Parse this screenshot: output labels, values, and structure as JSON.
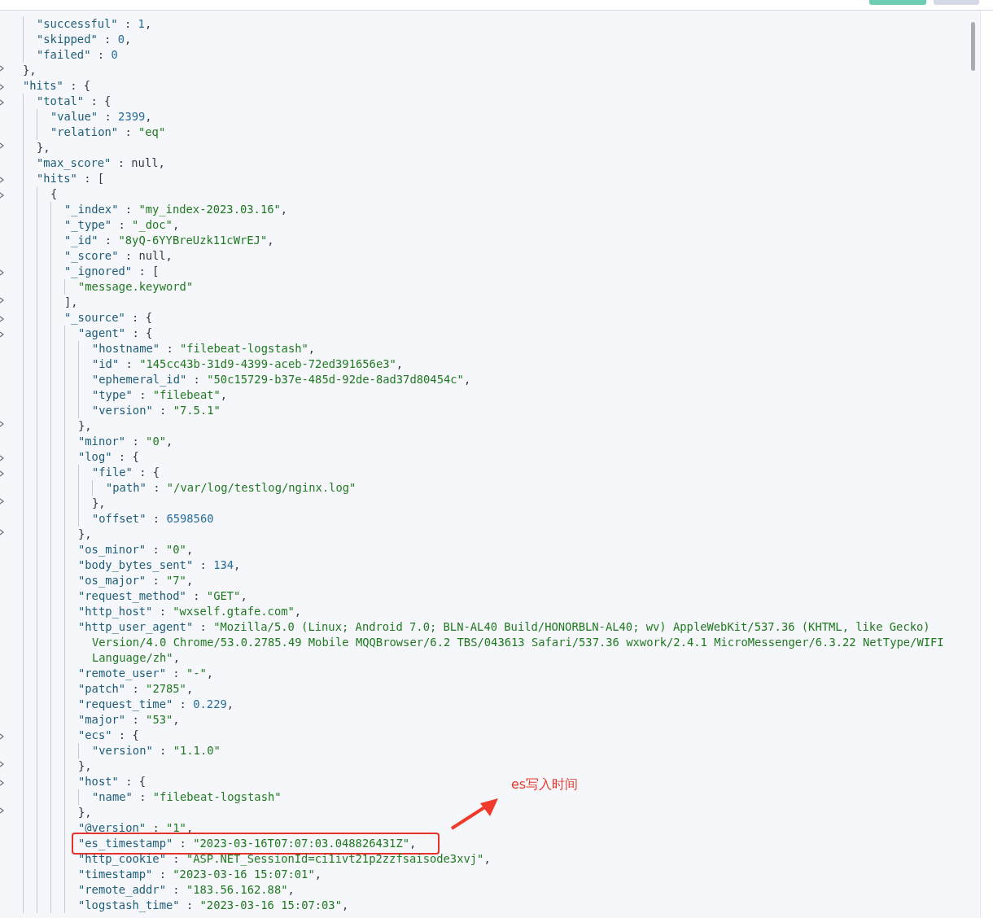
{
  "top_bar": {
    "badges": [
      {
        "kind": "status",
        "color": "#6dccb1"
      },
      {
        "kind": "time",
        "color": "#d3dae6"
      }
    ]
  },
  "response": {
    "items": [
      {
        "kind": "block",
        "children": [
          {
            "kind": "number",
            "key": "\"successful\"",
            "sep": " : ",
            "value": "1",
            "end": ","
          },
          {
            "kind": "number",
            "key": "\"skipped\"",
            "sep": " : ",
            "value": "0",
            "end": ","
          },
          {
            "kind": "number",
            "key": "\"failed\"",
            "sep": " : ",
            "value": "0"
          }
        ],
        "close": {
          "kind": "punct",
          "value": "},"
        }
      },
      {
        "kind": "block",
        "open": {
          "kind": "punct",
          "key": "\"hits\"",
          "sep": " : ",
          "value": "{"
        },
        "children": [
          {
            "kind": "block",
            "open": {
              "kind": "punct",
              "key": "\"total\"",
              "sep": " : ",
              "value": "{"
            },
            "children": [
              {
                "kind": "number",
                "key": "\"value\"",
                "sep": " : ",
                "value": "2399",
                "end": ","
              },
              {
                "kind": "string",
                "key": "\"relation\"",
                "sep": " : ",
                "value": "\"eq\""
              }
            ],
            "close": {
              "kind": "punct",
              "value": "},"
            }
          },
          {
            "kind": "null",
            "key": "\"max_score\"",
            "sep": " : ",
            "value": "null",
            "end": ","
          },
          {
            "kind": "block",
            "open": {
              "kind": "punct",
              "key": "\"hits\"",
              "sep": " : ",
              "value": "["
            },
            "children": [
              {
                "kind": "block",
                "open": {
                  "kind": "punct",
                  "value": "{"
                },
                "children": [
                  {
                    "kind": "string",
                    "key": "\"_index\"",
                    "sep": " : ",
                    "value": "\"my_index-2023.03.16\"",
                    "end": ","
                  },
                  {
                    "kind": "string",
                    "key": "\"_type\"",
                    "sep": " : ",
                    "value": "\"_doc\"",
                    "end": ","
                  },
                  {
                    "kind": "string",
                    "key": "\"_id\"",
                    "sep": " : ",
                    "value": "\"8yQ-6YYBreUzk11cWrEJ\"",
                    "end": ","
                  },
                  {
                    "kind": "null",
                    "key": "\"_score\"",
                    "sep": " : ",
                    "value": "null",
                    "end": ","
                  },
                  {
                    "kind": "block",
                    "open": {
                      "kind": "punct",
                      "key": "\"_ignored\"",
                      "sep": " : ",
                      "value": "["
                    },
                    "children": [
                      {
                        "kind": "string",
                        "value": "\"message.keyword\""
                      }
                    ],
                    "close": {
                      "kind": "punct",
                      "value": "],"
                    }
                  },
                  {
                    "kind": "block",
                    "open": {
                      "kind": "punct",
                      "key": "\"_source\"",
                      "sep": " : ",
                      "value": "{"
                    },
                    "children": [
                      {
                        "kind": "block",
                        "open": {
                          "kind": "punct",
                          "key": "\"agent\"",
                          "sep": " : ",
                          "value": "{"
                        },
                        "children": [
                          {
                            "kind": "string",
                            "key": "\"hostname\"",
                            "sep": " : ",
                            "value": "\"filebeat-logstash\"",
                            "end": ","
                          },
                          {
                            "kind": "string",
                            "key": "\"id\"",
                            "sep": " : ",
                            "value": "\"145cc43b-31d9-4399-aceb-72ed391656e3\"",
                            "end": ","
                          },
                          {
                            "kind": "string",
                            "key": "\"ephemeral_id\"",
                            "sep": " : ",
                            "value": "\"50c15729-b37e-485d-92de-8ad37d80454c\"",
                            "end": ","
                          },
                          {
                            "kind": "string",
                            "key": "\"type\"",
                            "sep": " : ",
                            "value": "\"filebeat\"",
                            "end": ","
                          },
                          {
                            "kind": "string",
                            "key": "\"version\"",
                            "sep": " : ",
                            "value": "\"7.5.1\""
                          }
                        ],
                        "close": {
                          "kind": "punct",
                          "value": "},"
                        }
                      },
                      {
                        "kind": "string",
                        "key": "\"minor\"",
                        "sep": " : ",
                        "value": "\"0\"",
                        "end": ","
                      },
                      {
                        "kind": "block",
                        "open": {
                          "kind": "punct",
                          "key": "\"log\"",
                          "sep": " : ",
                          "value": "{"
                        },
                        "children": [
                          {
                            "kind": "block",
                            "open": {
                              "kind": "punct",
                              "key": "\"file\"",
                              "sep": " : ",
                              "value": "{"
                            },
                            "children": [
                              {
                                "kind": "string",
                                "key": "\"path\"",
                                "sep": " : ",
                                "value": "\"/var/log/testlog/nginx.log\""
                              }
                            ],
                            "close": {
                              "kind": "punct",
                              "value": "},"
                            }
                          },
                          {
                            "kind": "number",
                            "key": "\"offset\"",
                            "sep": " : ",
                            "value": "6598560"
                          }
                        ],
                        "close": {
                          "kind": "punct",
                          "value": "},"
                        }
                      },
                      {
                        "kind": "string",
                        "key": "\"os_minor\"",
                        "sep": " : ",
                        "value": "\"0\"",
                        "end": ","
                      },
                      {
                        "kind": "number",
                        "key": "\"body_bytes_sent\"",
                        "sep": " : ",
                        "value": "134",
                        "end": ","
                      },
                      {
                        "kind": "string",
                        "key": "\"os_major\"",
                        "sep": " : ",
                        "value": "\"7\"",
                        "end": ","
                      },
                      {
                        "kind": "string",
                        "key": "\"request_method\"",
                        "sep": " : ",
                        "value": "\"GET\"",
                        "end": ","
                      },
                      {
                        "kind": "string",
                        "key": "\"http_host\"",
                        "sep": " : ",
                        "value": "\"wxself.gtafe.com\"",
                        "end": ","
                      },
                      {
                        "kind": "string",
                        "key": "\"http_user_agent\"",
                        "sep": " : ",
                        "value": "\"Mozilla/5.0 (Linux; Android 7.0; BLN-AL40 Build/HONORBLN-AL40; wv) AppleWebKit/537.36 (KHTML, like Gecko)",
                        "more": [
                          "Version/4.0 Chrome/53.0.2785.49 Mobile MQQBrowser/6.2 TBS/043613 Safari/537.36 wxwork/2.4.1 MicroMessenger/6.3.22 NetType/WIFI",
                          "Language/zh\""
                        ],
                        "end": ","
                      },
                      {
                        "kind": "string",
                        "key": "\"remote_user\"",
                        "sep": " : ",
                        "value": "\"-\"",
                        "end": ","
                      },
                      {
                        "kind": "string",
                        "key": "\"patch\"",
                        "sep": " : ",
                        "value": "\"2785\"",
                        "end": ","
                      },
                      {
                        "kind": "number",
                        "key": "\"request_time\"",
                        "sep": " : ",
                        "value": "0.229",
                        "end": ","
                      },
                      {
                        "kind": "string",
                        "key": "\"major\"",
                        "sep": " : ",
                        "value": "\"53\"",
                        "end": ","
                      },
                      {
                        "kind": "block",
                        "open": {
                          "kind": "punct",
                          "key": "\"ecs\"",
                          "sep": " : ",
                          "value": "{"
                        },
                        "children": [
                          {
                            "kind": "string",
                            "key": "\"version\"",
                            "sep": " : ",
                            "value": "\"1.1.0\""
                          }
                        ],
                        "close": {
                          "kind": "punct",
                          "value": "},"
                        }
                      },
                      {
                        "kind": "block",
                        "open": {
                          "kind": "punct",
                          "key": "\"host\"",
                          "sep": " : ",
                          "value": "{"
                        },
                        "children": [
                          {
                            "kind": "string",
                            "key": "\"name\"",
                            "sep": " : ",
                            "value": "\"filebeat-logstash\""
                          }
                        ],
                        "close": {
                          "kind": "punct",
                          "value": "},"
                        }
                      },
                      {
                        "kind": "string",
                        "key": "\"@version\"",
                        "sep": " : ",
                        "value": "\"1\"",
                        "end": ","
                      },
                      {
                        "kind": "string",
                        "key": "\"es_timestamp\"",
                        "sep": " : ",
                        "value": "\"2023-03-16T07:07:03.048826431Z\"",
                        "end": ",",
                        "highlighted": true
                      },
                      {
                        "kind": "string",
                        "key": "\"http_cookie\"",
                        "sep": " : ",
                        "value": "\"ASP.NET_SessionId=ci1ivt21p2zzfsaisode3xvj\"",
                        "end": ","
                      },
                      {
                        "kind": "string",
                        "key": "\"timestamp\"",
                        "sep": " : ",
                        "value": "\"2023-03-16 15:07:01\"",
                        "end": ","
                      },
                      {
                        "kind": "string",
                        "key": "\"remote_addr\"",
                        "sep": " : ",
                        "value": "\"183.56.162.88\"",
                        "end": ","
                      },
                      {
                        "kind": "string",
                        "key": "\"logstash_time\"",
                        "sep": " : ",
                        "value": "\"2023-03-16 15:07:03\"",
                        "end": ","
                      }
                    ]
                  }
                ]
              }
            ]
          }
        ]
      }
    ]
  },
  "annotation": {
    "text": "es写入时间"
  }
}
